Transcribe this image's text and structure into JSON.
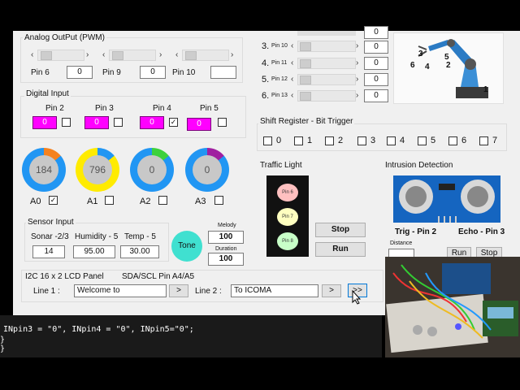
{
  "analog": {
    "title": "Analog OutPut (PWM)",
    "channels": [
      {
        "label": "Pin 6",
        "value": "0"
      },
      {
        "label": "Pin 9",
        "value": "0"
      },
      {
        "label": "Pin 10",
        "value": ""
      }
    ]
  },
  "shift_pins": [
    {
      "num": "3.",
      "pin": "Pin 10",
      "value": "0"
    },
    {
      "num": "4.",
      "pin": "Pin 11",
      "value": "0"
    },
    {
      "num": "5.",
      "pin": "Pin 12",
      "value": "0"
    },
    {
      "num": "6.",
      "pin": "Pin 13",
      "value": "0"
    }
  ],
  "top_value": "0",
  "digital": {
    "title": "Digital Input",
    "pins": [
      {
        "label": "Pin 2",
        "value": "0",
        "checked": false
      },
      {
        "label": "Pin 3",
        "value": "0",
        "checked": false
      },
      {
        "label": "Pin 4",
        "value": "0",
        "checked": true
      },
      {
        "label": "Pin 5",
        "value": "0",
        "checked": false
      }
    ]
  },
  "gauges": [
    {
      "label": "A0",
      "value": "184",
      "checked": true,
      "ring": "#2196f3",
      "accent": "#f5821f"
    },
    {
      "label": "A1",
      "value": "796",
      "checked": false,
      "ring": "#ffeb00",
      "accent": "#2196f3"
    },
    {
      "label": "A2",
      "value": "0",
      "checked": false,
      "ring": "#2196f3",
      "accent": "#3dd13d"
    },
    {
      "label": "A3",
      "value": "0",
      "checked": false,
      "ring": "#2196f3",
      "accent": "#a020a0"
    }
  ],
  "shift_register": {
    "title": "Shift Register - Bit Trigger",
    "bits": [
      "0",
      "1",
      "2",
      "3",
      "4",
      "5",
      "6",
      "7"
    ]
  },
  "traffic": {
    "title": "Traffic Light",
    "lights": [
      {
        "label": "Pin 6",
        "color": "#ffc0c0"
      },
      {
        "label": "Pin 7",
        "color": "#ffffc0"
      },
      {
        "label": "Pin 8",
        "color": "#c8ffc8"
      }
    ],
    "stop_label": "Stop",
    "run_label": "Run"
  },
  "intrusion": {
    "title": "Intrusion Detection",
    "trig_label": "Trig - Pin 2",
    "echo_label": "Echo - Pin 3",
    "distance_label": "Distance",
    "run_label": "Run",
    "stop_label": "Stop"
  },
  "sensor": {
    "title": "Sensor Input",
    "fields": [
      {
        "label": "Sonar -2/3",
        "value": "14"
      },
      {
        "label": "Humidity - 5",
        "value": "95.00"
      },
      {
        "label": "Temp - 5",
        "value": "30.00"
      }
    ]
  },
  "tone": {
    "label": "Tone",
    "melody_label": "Melody",
    "melody_value": "100",
    "duration_label": "Duration",
    "duration_value": "100"
  },
  "lcd": {
    "title": "I2C 16 x 2 LCD Panel",
    "sub": "SDA/SCL  Pin A4/A5",
    "line1_label": "Line 1 :",
    "line1_value": "Welcome to",
    "line2_label": "Line 2 :",
    "line2_value": "To ICOMA",
    "send_label": ">",
    "next_label": ">>"
  },
  "console": {
    "line1": "INpin3 = \"0\", INpin4 = \"0\", INpin5=\"0\";",
    "line2": "}",
    "line3": "}"
  },
  "robot_labels": [
    "6",
    "5",
    "4",
    "3",
    "2",
    "1"
  ]
}
